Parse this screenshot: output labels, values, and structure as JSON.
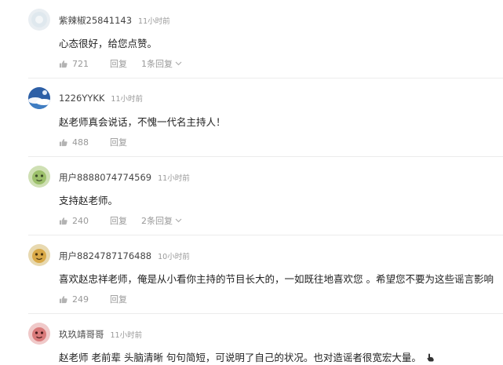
{
  "comments": [
    {
      "username": "紫辣椒25841143",
      "time": "11小时前",
      "content": "心态很好，给您点赞。",
      "likes": "721",
      "reply_label": "回复",
      "replies_label": "1条回复"
    },
    {
      "username": "1226YYKK",
      "time": "11小时前",
      "content": "赵老师真会说话，不愧一代名主持人！",
      "likes": "488",
      "reply_label": "回复"
    },
    {
      "username": "用户8888074774569",
      "time": "11小时前",
      "content": "支持赵老师。",
      "likes": "240",
      "reply_label": "回复",
      "replies_label": "2条回复"
    },
    {
      "username": "用户8824787176488",
      "time": "10小时前",
      "content": "喜欢赵忠祥老师，俺是从小看你主持的节目长大的，一如既往地喜欢您 。希望您不要为这些谣言影响",
      "likes": "249",
      "reply_label": "回复"
    },
    {
      "username": "玖玖靖哥哥",
      "time": "11小时前",
      "content": "赵老师 老前辈 头脑清晰 句句简短，可说明了自己的状况。也对造谣者很宽宏大量。"
    }
  ],
  "icons": {
    "like": "thumbs-up-icon",
    "expand": "chevron-down-icon",
    "trailing_emoji": "pointing-hand-icon"
  }
}
